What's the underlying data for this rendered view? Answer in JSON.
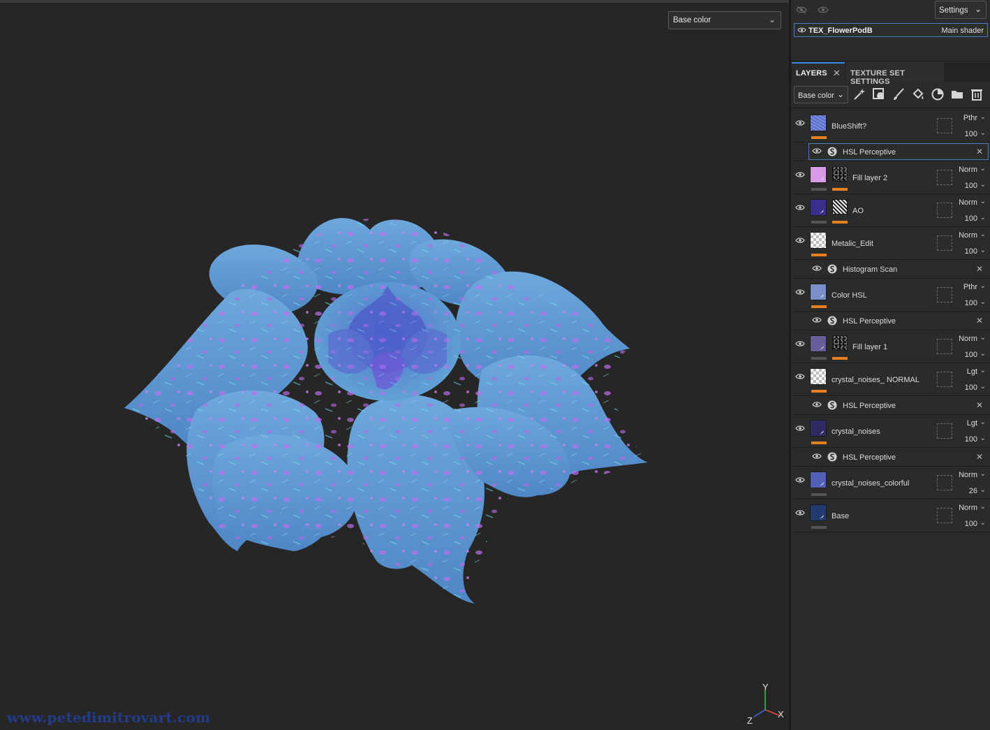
{
  "viewport": {
    "channel": "Base color",
    "watermark": "www.petedimitrovart.com",
    "gizmo": {
      "y": "Y",
      "x": "X",
      "z": "Z"
    }
  },
  "panel": {
    "settings_label": "Settings",
    "texture_set": {
      "name": "TEX_FlowerPodB",
      "shader": "Main shader"
    },
    "tabs": [
      {
        "label": "LAYERS"
      },
      {
        "label": "TEXTURE SET SETTINGS"
      }
    ],
    "channel": "Base color",
    "tools": [
      "magic-wand-icon",
      "mask-icon",
      "paint-brush-icon",
      "fill-bucket-icon",
      "smart-material-icon",
      "folder-icon",
      "trash-icon"
    ]
  },
  "layers": [
    {
      "kind": "layer",
      "name": "BlueShift?",
      "blend": "Pthr",
      "opacity": "100",
      "thumb": "#5b6fc9",
      "thumbstyle": "blueshift",
      "mask": false,
      "bar": "orange"
    },
    {
      "kind": "effect",
      "name": "HSL Perceptive",
      "selected": true
    },
    {
      "kind": "layer",
      "name": "Fill layer 2",
      "blend": "Norm",
      "opacity": "100",
      "thumb": "#d79ae6",
      "mask": "dark",
      "bar": "gray"
    },
    {
      "kind": "layer",
      "name": "AO",
      "blend": "Norm",
      "opacity": "100",
      "thumb": "#3b2f8c",
      "mask": "noise",
      "bar": "gray"
    },
    {
      "kind": "layer",
      "name": "Metalic_Edit",
      "blend": "Norm",
      "opacity": "100",
      "thumb": "checker",
      "mask": false,
      "bar": "orange"
    },
    {
      "kind": "effect",
      "name": "Histogram Scan"
    },
    {
      "kind": "layer",
      "name": "Color HSL",
      "blend": "Pthr",
      "opacity": "100",
      "thumb": "#7a8ec7",
      "mask": false,
      "bar": "orange"
    },
    {
      "kind": "effect",
      "name": "HSL Perceptive"
    },
    {
      "kind": "layer",
      "name": "Fill layer 1",
      "blend": "Norm",
      "opacity": "100",
      "thumb": "#6a5e9a",
      "mask": "dark2",
      "bar": "gray"
    },
    {
      "kind": "layer",
      "name": "crystal_noises_ NORMAL",
      "blend": "Lgt",
      "opacity": "100",
      "thumb": "checker",
      "mask": false,
      "bar": "orange"
    },
    {
      "kind": "effect",
      "name": "HSL Perceptive"
    },
    {
      "kind": "layer",
      "name": "crystal_noises",
      "blend": "Lgt",
      "opacity": "100",
      "thumb": "#302a63",
      "mask": false,
      "bar": "orange"
    },
    {
      "kind": "effect",
      "name": "HSL Perceptive"
    },
    {
      "kind": "layer",
      "name": "crystal_noises_colorful",
      "blend": "Norm",
      "opacity": "26",
      "thumb": "#5260b8",
      "mask": false,
      "bar": "gray"
    },
    {
      "kind": "layer",
      "name": "Base",
      "blend": "Norm",
      "opacity": "100",
      "thumb": "#233a6e",
      "mask": false,
      "bar": "gray"
    }
  ],
  "colors": {
    "accent": "#3a88e0",
    "orange": "#e67e22",
    "panel": "#2b2b2b",
    "viewport": "#262626"
  }
}
